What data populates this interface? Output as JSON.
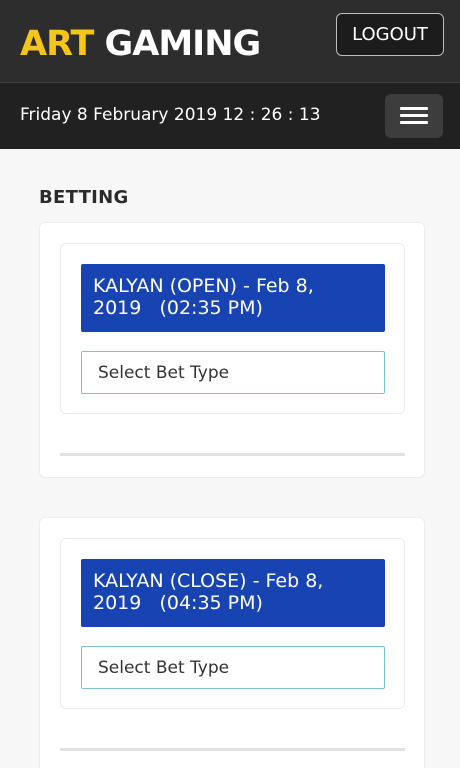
{
  "header": {
    "logo_part1": "ART",
    "logo_part2": " GAMING",
    "logout_label": "LOGOUT"
  },
  "datebar": {
    "datetime": "Friday 8 February 2019 12 : 26 : 13",
    "menu_icon": "hamburger-menu-icon"
  },
  "section": {
    "title": "BETTING"
  },
  "markets": [
    {
      "title_line1": "KALYAN (OPEN) - Feb 8,",
      "title_line2": "2019   (02:35 PM)",
      "select_placeholder": "Select Bet Type"
    },
    {
      "title_line1": "KALYAN (CLOSE) - Feb 8,",
      "title_line2": "2019   (04:35 PM)",
      "select_placeholder": "Select Bet Type"
    }
  ],
  "colors": {
    "topbar": "#2d2d2d",
    "datebar": "#212121",
    "logo_accent": "#f5c518",
    "market_header": "#1743b3",
    "select_border": "#7fbfd8"
  }
}
